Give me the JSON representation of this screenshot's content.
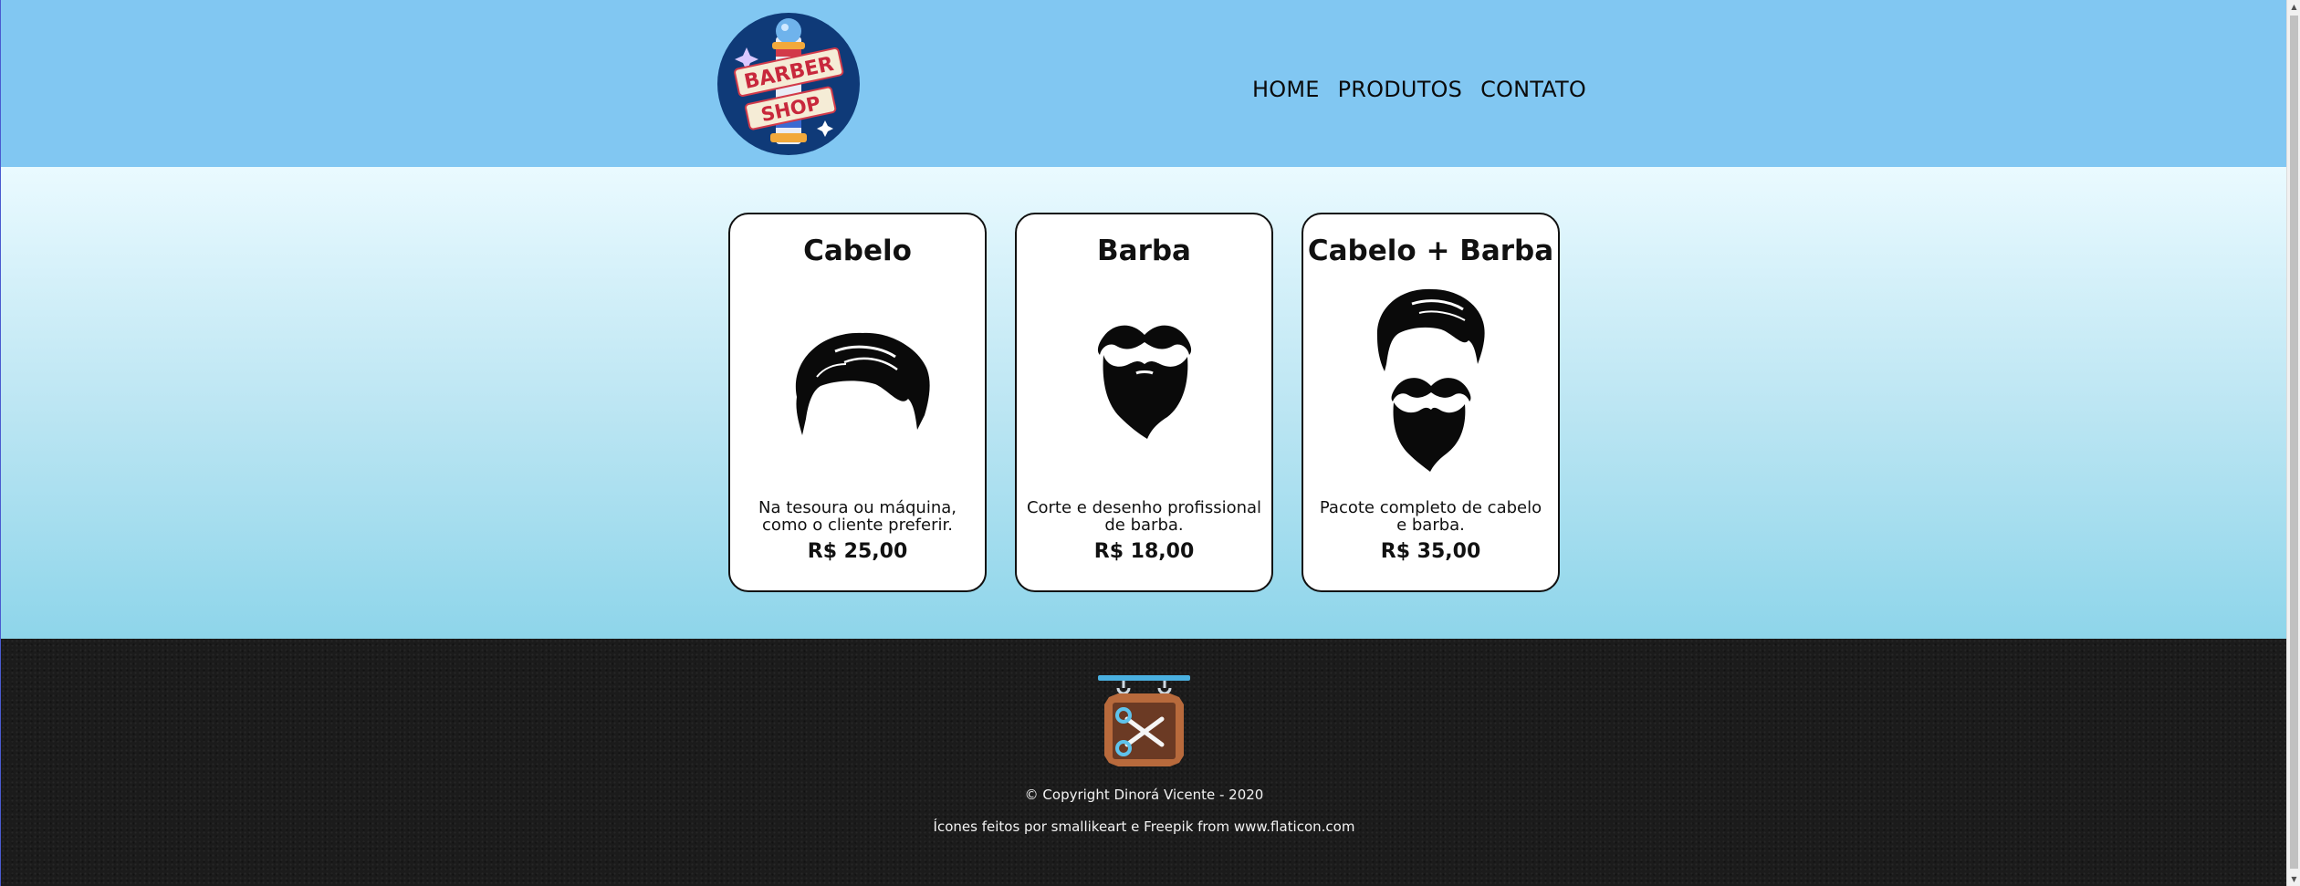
{
  "header": {
    "logo_text_top": "BARBER",
    "logo_text_bottom": "SHOP",
    "nav": [
      {
        "label": "HOME"
      },
      {
        "label": "PRODUTOS"
      },
      {
        "label": "CONTATO"
      }
    ]
  },
  "products": [
    {
      "title": "Cabelo",
      "icon": "hair-icon",
      "description": "Na tesoura ou máquina, como o cliente preferir.",
      "price": "R$ 25,00"
    },
    {
      "title": "Barba",
      "icon": "beard-icon",
      "description": "Corte e desenho profissional de barba.",
      "price": "R$ 18,00"
    },
    {
      "title": "Cabelo + Barba",
      "icon": "hair-and-beard-icon",
      "description": "Pacote completo de cabelo e barba.",
      "price": "R$ 35,00"
    }
  ],
  "footer": {
    "logo_icon": "barber-sign-scissors-icon",
    "copyright": "© Copyright Dinorá Vicente - 2020",
    "credits": "Ícones feitos por smallikeart e Freepik from www.flaticon.com"
  },
  "colors": {
    "header_bg": "#81c7f2",
    "footer_bg": "#1b1b1b",
    "card_bg": "#ffffff"
  }
}
